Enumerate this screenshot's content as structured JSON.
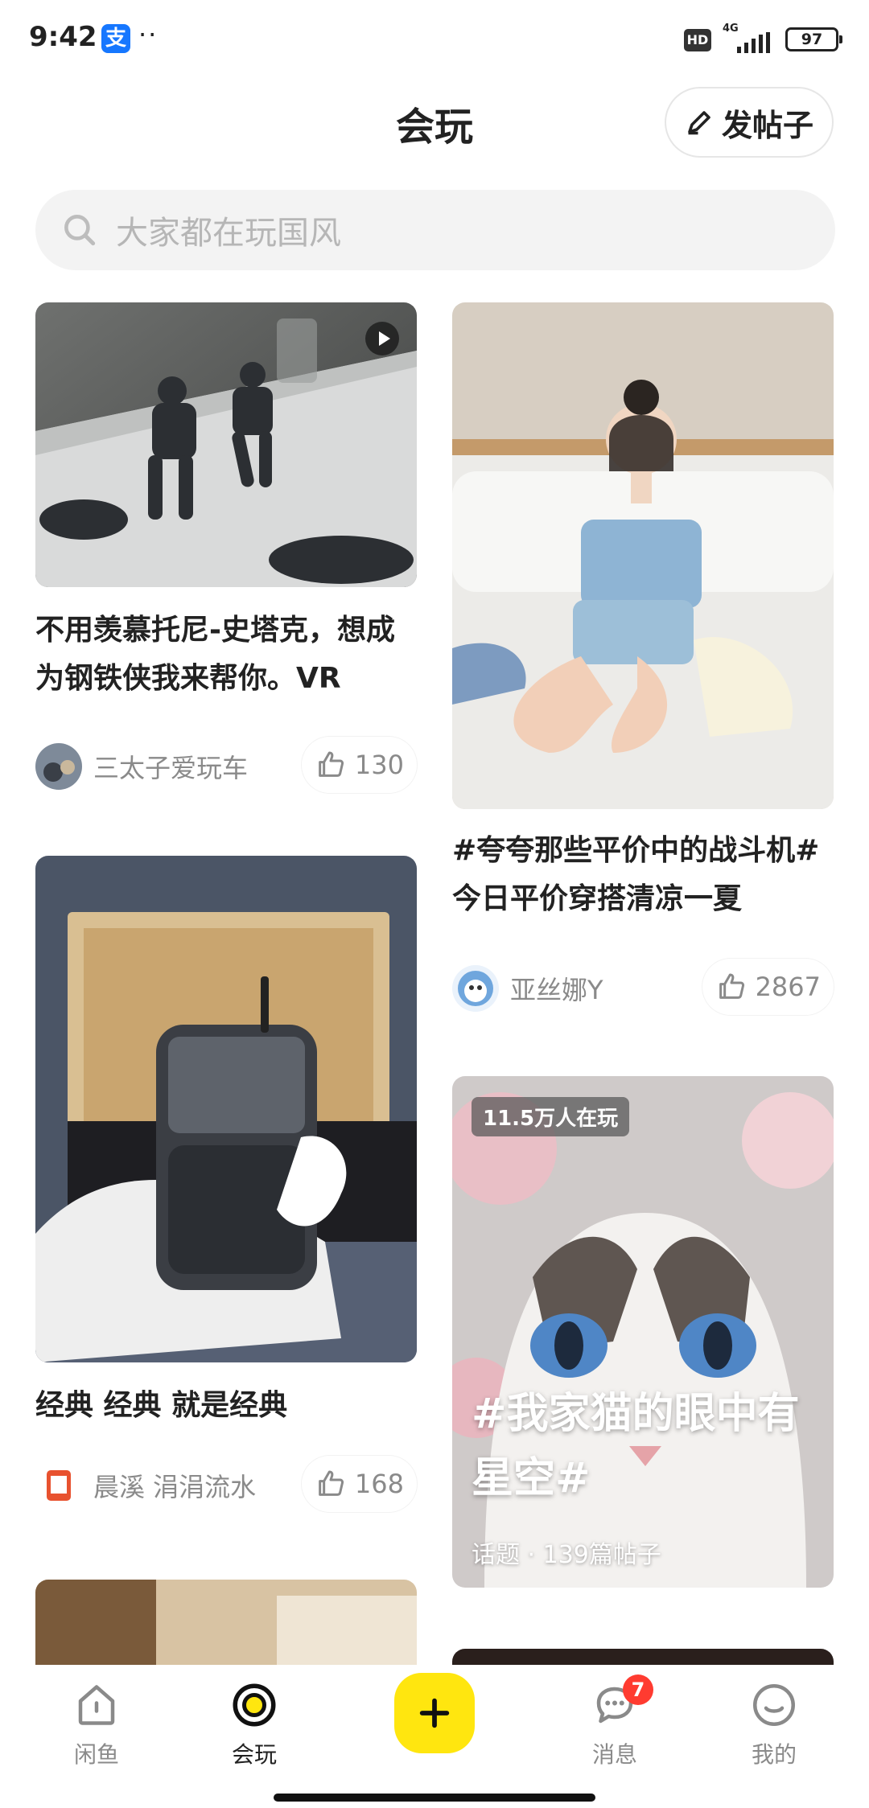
{
  "status_bar": {
    "time": "9:42",
    "alipay_glyph": "支",
    "dots": "··",
    "hd": "HD",
    "network": "4G",
    "battery": "97"
  },
  "header": {
    "title": "会玩",
    "post_button": "发帖子"
  },
  "search": {
    "placeholder": "大家都在玩国风"
  },
  "feed": {
    "left": [
      {
        "title": "不用羡慕托尼-史塔克，想成为钢铁侠我来帮你。VR",
        "author": "三太子爱玩车",
        "likes": "130"
      },
      {
        "title": "经典 经典 就是经典",
        "author": "晨溪 涓涓流水",
        "likes": "168"
      }
    ],
    "right": [
      {
        "title": "#夸夸那些平价中的战斗机# 今日平价穿搭清凉一夏",
        "author": "亚丝娜Y",
        "likes": "2867"
      },
      {
        "badge": "11.5万人在玩",
        "topic_title": "#我家猫的眼中有星空#",
        "topic_sub": "话题 · 139篇帖子"
      }
    ]
  },
  "nav": {
    "items": [
      {
        "label": "闲鱼",
        "icon": "home-icon"
      },
      {
        "label": "会玩",
        "icon": "play-circle-icon"
      },
      {
        "label": "",
        "icon": "plus-icon"
      },
      {
        "label": "消息",
        "icon": "message-icon",
        "badge": "7"
      },
      {
        "label": "我的",
        "icon": "smile-face-icon"
      }
    ]
  },
  "colors": {
    "accent": "#ffe60f",
    "badge_red": "#ff3b30",
    "text_muted": "#8a8a8a"
  }
}
